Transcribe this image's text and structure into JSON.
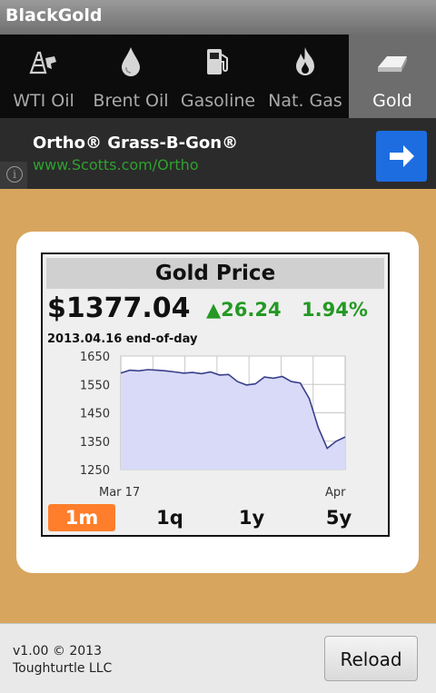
{
  "app": {
    "title": "BlackGold"
  },
  "tabs": [
    {
      "label": "WTI Oil",
      "icon": "oil-derrick-icon"
    },
    {
      "label": "Brent Oil",
      "icon": "oil-drop-icon"
    },
    {
      "label": "Gasoline",
      "icon": "gas-pump-icon"
    },
    {
      "label": "Nat. Gas",
      "icon": "flame-icon"
    },
    {
      "label": "Gold",
      "icon": "gold-bar-icon",
      "selected": true
    }
  ],
  "ad": {
    "headline": "Ortho® Grass-B-Gon®",
    "url": "www.Scotts.com/Ortho",
    "info": "i"
  },
  "quote": {
    "heading": "Gold Price",
    "price": "$1377.04",
    "change": "▲26.24",
    "change_pct": "1.94%",
    "asof": "2013.04.16 end-of-day"
  },
  "chart_data": {
    "type": "area",
    "x_tick_labels": [
      "Mar 17",
      "Apr"
    ],
    "y_ticks": [
      1650,
      1550,
      1450,
      1350,
      1250
    ],
    "ylim": [
      1250,
      1650
    ],
    "grid": true,
    "values": [
      1590,
      1600,
      1598,
      1602,
      1600,
      1598,
      1594,
      1590,
      1592,
      1588,
      1594,
      1583,
      1585,
      1560,
      1548,
      1552,
      1576,
      1572,
      1578,
      1560,
      1555,
      1500,
      1398,
      1325,
      1350,
      1365
    ]
  },
  "ranges": {
    "items": [
      "1m",
      "1q",
      "1y",
      "5y"
    ],
    "selected": "1m"
  },
  "footer": {
    "line1": "v1.00 © 2013",
    "line2": "Toughturtle LLC",
    "reload_label": "Reload"
  },
  "colors": {
    "accent": "#ff7e2b",
    "positive": "#249924",
    "fill": "#d8daf8",
    "line": "#3a3f8a"
  }
}
